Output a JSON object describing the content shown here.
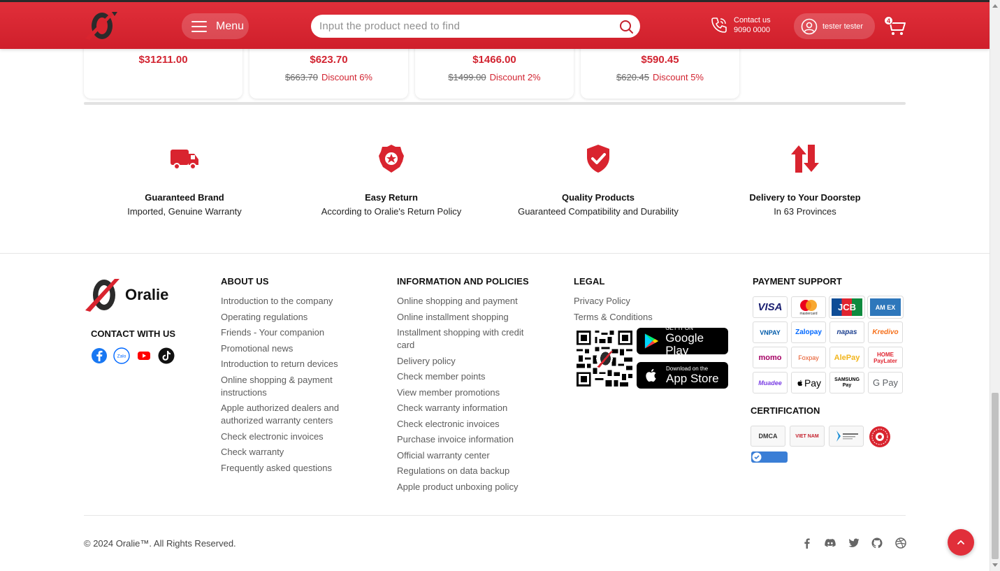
{
  "header": {
    "menu_label": "Menu",
    "search_placeholder": "Input the product need to find",
    "contact_label": "Contact us",
    "contact_phone": "9090 0000",
    "user_name": "tester tester",
    "cart_count": "4",
    "brand_color": "#d22431"
  },
  "products": [
    {
      "price": "$31211.00",
      "old_price": "",
      "discount": ""
    },
    {
      "price": "$623.70",
      "old_price": "$663.70",
      "discount": "Discount 6%"
    },
    {
      "price": "$1466.00",
      "old_price": "$1499.00",
      "discount": "Discount 2%"
    },
    {
      "price": "$590.45",
      "old_price": "$620.45",
      "discount": "Discount 5%"
    }
  ],
  "features": [
    {
      "icon": "delivery-truck-icon",
      "title": "Guaranteed Brand",
      "subtitle": "Imported, Genuine Warranty"
    },
    {
      "icon": "police-badge-icon",
      "title": "Easy Return",
      "subtitle": "According to Oralie's Return Policy"
    },
    {
      "icon": "shield-check-icon",
      "title": "Quality Products",
      "subtitle": "Guaranteed Compatibility and Durability"
    },
    {
      "icon": "exchange-arrows-icon",
      "title": "Delivery to Your Doorstep",
      "subtitle": "In 63 Provinces"
    }
  ],
  "footer": {
    "brand": "Oralie",
    "contact_title": "CONTACT WITH US",
    "about": {
      "title": "ABOUT US",
      "items": [
        "Introduction to the company",
        "Operating regulations",
        "Friends - Your companion",
        "Promotional news",
        "Introduction to return devices",
        "Online shopping & payment instructions",
        "Apple authorized dealers and authorized warranty centers",
        "Check electronic invoices",
        "Check warranty",
        "Frequently asked questions"
      ]
    },
    "info": {
      "title": "INFORMATION AND POLICIES",
      "items": [
        "Online shopping and payment",
        "Online installment shopping",
        "Installment shopping with credit card",
        "Delivery policy",
        "Check member points",
        "View member promotions",
        "Check warranty information",
        "Check electronic invoices",
        "Purchase invoice information",
        "Official warranty center",
        "Regulations on data backup",
        "Apple product unboxing policy"
      ]
    },
    "legal": {
      "title": "LEGAL",
      "items": [
        "Privacy Policy",
        "Terms & Conditions"
      ],
      "google_small": "GET IT ON",
      "google_big": "Google Play",
      "apple_small": "Download on the",
      "apple_big": "App Store"
    },
    "payment": {
      "title": "PAYMENT SUPPORT",
      "methods": [
        "VISA",
        "mastercard",
        "JCB",
        "AM EX",
        "VNPAY",
        "Zalopay",
        "napas",
        "Kredivo",
        "momo",
        "Foxpay",
        "AlePay",
        "HOME PayLater",
        "Muadee",
        "Pay",
        "SAMSUNG Pay",
        "G Pay"
      ]
    },
    "certification": {
      "title": "CERTIFICATION",
      "badges": [
        "DMCA",
        "VIET NAM",
        "",
        ""
      ]
    },
    "copyright": "© 2024 Oralie™. All Rights Reserved."
  }
}
